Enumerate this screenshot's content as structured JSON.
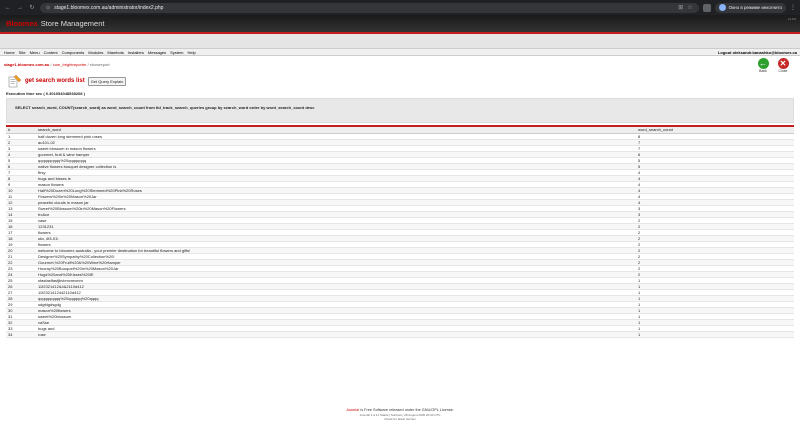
{
  "browser": {
    "url": "stage1.bloomex.com.au/administrator/index2.php",
    "incognito_label": "Окно в режиме инкогнито"
  },
  "header": {
    "brand": "Bloomex",
    "brand_sub": "Store Management",
    "version": "v1.0.0"
  },
  "menu": {
    "items": [
      "Home",
      "Site",
      "Menu",
      "Content",
      "Components",
      "Modules",
      "Mambots",
      "Installers",
      "Messages",
      "System",
      "Help"
    ],
    "logout": "Logout oleksandr.banashko@bloomex.ca"
  },
  "breadcrumb": {
    "site": "stage1.bloomex.com.au",
    "component": "com_brightreporter",
    "page": "showreport"
  },
  "toolbar": {
    "back": "Back",
    "close": "Close"
  },
  "title": {
    "text": "get search words list",
    "query_button": "Get Query Explain"
  },
  "execution": "Execution time sec ( 0.301054048538208 )",
  "sql": "SELECT search_word, COUNT(search_word) as word_search_count from tbl_track_search_queries group by search_word order by word_search_count desc",
  "table": {
    "headers": [
      "#",
      "search_word",
      "word_search_count"
    ],
    "rows": [
      [
        "1",
        "half dozen long stemmed pink roses",
        "8"
      ],
      [
        "2",
        "au101-02",
        "7"
      ],
      [
        "3",
        "sweet blossom in mason flowers",
        "7"
      ],
      [
        "4",
        "gourmet, fruit & wine hamper",
        "6"
      ],
      [
        "5",
        "qqqqqqqqqq%20qqqqqqqq",
        "5"
      ],
      [
        "6",
        "native flowers bouquet designer collection is",
        "5"
      ],
      [
        "7",
        "ffrsy",
        "4"
      ],
      [
        "8",
        "hugs and kisses ie",
        "4"
      ],
      [
        "9",
        "mason flowers",
        "4"
      ],
      [
        "10",
        "Half%20Dozen%20Long%20Stemmed%20Pink%20Roses",
        "4"
      ],
      [
        "11",
        "Flowers%20in%20Mason%20Jar",
        "4"
      ],
      [
        "12",
        "peaceful clouds in mason jar",
        "4"
      ],
      [
        "13",
        "Sweet%20Blossom%20in%20Mason%20Flowers",
        "3"
      ],
      [
        "14",
        "frc&ce",
        "3"
      ],
      [
        "15",
        "vase",
        "2"
      ],
      [
        "16",
        "1231231",
        "2"
      ],
      [
        "17",
        "flowers",
        "2"
      ],
      [
        "18",
        "skv, 4t3-01\\",
        "2"
      ],
      [
        "19",
        "flowers",
        "2"
      ],
      [
        "20",
        "welcome to bloomex australia - your premier destination for beautiful flowers and gifts!",
        "2"
      ],
      [
        "21",
        "Designer%20Sympathy%20Collection%20!",
        "2"
      ],
      [
        "22",
        "Gourmet,%20Fruit%20&%20Wine%20Hamper",
        "2"
      ],
      [
        "23",
        "Hooray%20Bouquet%20in%20Mason%20Jar",
        "2"
      ],
      [
        "24",
        "Hugs%20and%20Kisses%20IE",
        "2"
      ],
      [
        "25",
        "sfasfasffasfjbvbmvmvmm",
        "1"
      ],
      [
        "26",
        "11f2321412&4&2110d412",
        "1"
      ],
      [
        "27",
        "11f2321412442110d412",
        "1"
      ],
      [
        "28",
        "qqqqqqqqqq%20qqqqqq%20qqqq",
        "1"
      ],
      [
        "29",
        "sdgfdgdsgdg",
        "1"
      ],
      [
        "30",
        "mason%20flowers",
        "1"
      ],
      [
        "31",
        "sweet%20blossom",
        "1"
      ],
      [
        "32",
        "vaSse",
        "1"
      ],
      [
        "33",
        "hugs and",
        "1"
      ],
      [
        "34",
        "rose",
        "1"
      ]
    ]
  },
  "footer": {
    "line1_link": "Joomla!",
    "line1_rest": " is Free Software released under the GNU/GPL License.",
    "line2": "Joomla! 1.0.11 Stable [ Sunbow ] 28 August 2006 20:00 UTC",
    "line3": "Check for latest Version"
  },
  "colors": {
    "accent": "#c41d1d",
    "back_button": "#2e9e2e",
    "close_button": "#c62828"
  }
}
